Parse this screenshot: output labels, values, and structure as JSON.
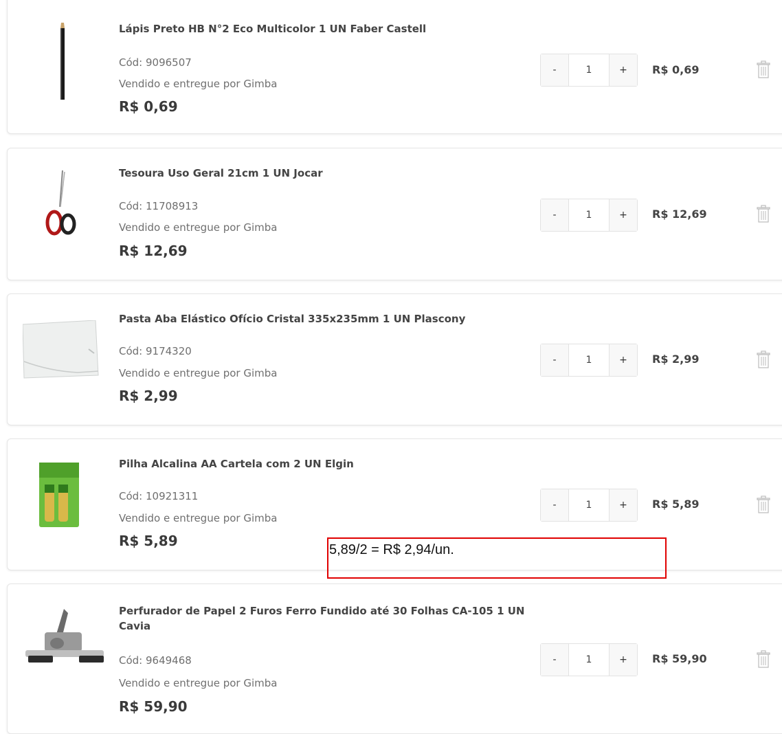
{
  "cart": {
    "items": [
      {
        "name": "Lápis Preto HB N°2 Eco Multicolor 1 UN Faber Castell",
        "code": "Cód: 9096507",
        "seller": "Vendido e entregue por Gimba",
        "unit_price": "R$ 0,69",
        "qty": "1",
        "minus": "-",
        "plus": "+",
        "total": "R$ 0,69",
        "image_icon": "pencil-icon"
      },
      {
        "name": "Tesoura Uso Geral 21cm 1 UN Jocar",
        "code": "Cód: 11708913",
        "seller": "Vendido e entregue por Gimba",
        "unit_price": "R$ 12,69",
        "qty": "1",
        "minus": "-",
        "plus": "+",
        "total": "R$ 12,69",
        "image_icon": "scissors-icon"
      },
      {
        "name": "Pasta Aba Elástico Ofício Cristal 335x235mm 1 UN Plascony",
        "code": "Cód: 9174320",
        "seller": "Vendido e entregue por Gimba",
        "unit_price": "R$ 2,99",
        "qty": "1",
        "minus": "-",
        "plus": "+",
        "total": "R$ 2,99",
        "image_icon": "folder-icon"
      },
      {
        "name": "Pilha Alcalina AA Cartela com 2 UN Elgin",
        "code": "Cód: 10921311",
        "seller": "Vendido e entregue por Gimba",
        "unit_price": "R$ 5,89",
        "qty": "1",
        "minus": "-",
        "plus": "+",
        "total": "R$ 5,89",
        "image_icon": "battery-pack-icon"
      },
      {
        "name": "Perfurador de Papel 2 Furos Ferro Fundido até 30 Folhas CA-105 1 UN Cavia",
        "code": "Cód: 9649468",
        "seller": "Vendido e entregue por Gimba",
        "unit_price": "R$ 59,90",
        "qty": "1",
        "minus": "-",
        "plus": "+",
        "total": "R$ 59,90",
        "image_icon": "hole-punch-icon"
      }
    ],
    "trash_icon": "trash-icon"
  },
  "annotation": {
    "text": "5,89/2 = R$ 2,94/un.",
    "border_color": "#e00000"
  }
}
